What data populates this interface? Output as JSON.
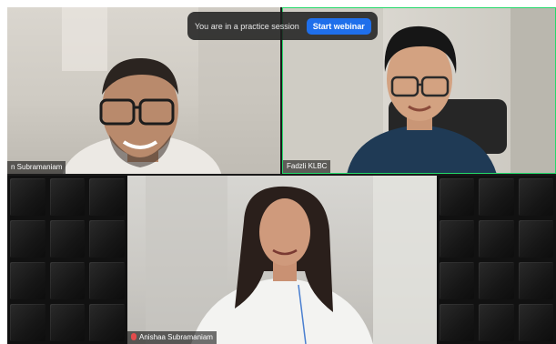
{
  "banner": {
    "message": "You are in a practice session",
    "button_label": "Start webinar",
    "button_color": "#1f6feb"
  },
  "participants": [
    {
      "name": "n Subramaniam",
      "muted": false,
      "active_speaker": false
    },
    {
      "name": "Fadzli KLBC",
      "muted": false,
      "active_speaker": true
    },
    {
      "name": "Anishaa Subramaniam",
      "muted": true,
      "active_speaker": false
    }
  ],
  "colors": {
    "active_speaker_border": "#23d96a",
    "muted_icon": "#e34b4b"
  },
  "icons": [
    "mic-muted-icon"
  ]
}
